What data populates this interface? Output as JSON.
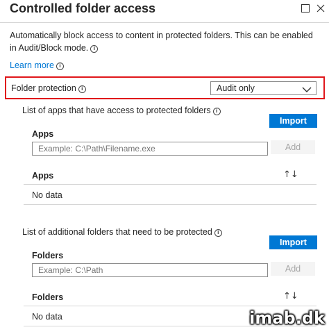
{
  "header": {
    "title": "Controlled folder access",
    "maximize_icon": "maximize-icon",
    "close_icon": "close-icon"
  },
  "description": "Automatically block access to content in protected folders. This can be enabled in Audit/Block mode.",
  "learn_more": "Learn more",
  "folder_protection": {
    "label": "Folder protection",
    "selected": "Audit only"
  },
  "apps_section": {
    "title": "List of apps that have access to protected folders",
    "import_label": "Import",
    "field_label": "Apps",
    "placeholder": "Example: C:\\Path\\Filename.exe",
    "add_label": "Add",
    "column_header": "Apps",
    "empty_text": "No data"
  },
  "folders_section": {
    "title": "List of additional folders that need to be protected",
    "import_label": "Import",
    "field_label": "Folders",
    "placeholder": "Example: C:\\Path",
    "add_label": "Add",
    "column_header": "Folders",
    "empty_text": "No data"
  },
  "watermark": "imab.dk",
  "colors": {
    "accent": "#0078d4",
    "highlight_border": "#e0161b"
  }
}
